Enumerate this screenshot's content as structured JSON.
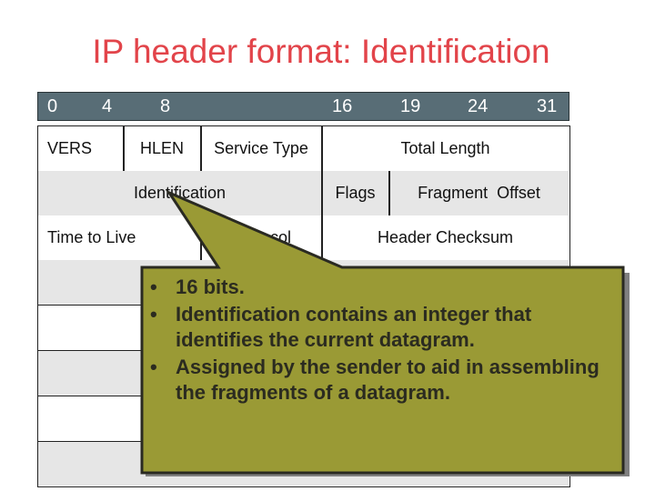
{
  "slide": {
    "title": "IP header format: Identification"
  },
  "bit_positions": [
    "0",
    "4",
    "8",
    "16",
    "19",
    "24",
    "31"
  ],
  "header_table": {
    "rows": [
      {
        "cells": [
          "VERS",
          "HLEN",
          "Service Type",
          "Total Length"
        ]
      },
      {
        "cells": [
          "Identification",
          "Flags",
          "Fragment  Offset"
        ]
      },
      {
        "cells": [
          "Time to Live",
          "Protocol",
          "Header Checksum"
        ]
      },
      {
        "cells": []
      },
      {
        "cells": []
      },
      {
        "cells": []
      },
      {
        "cells": []
      },
      {
        "cells": []
      }
    ]
  },
  "callout": {
    "highlighted_field": "Identification",
    "bullet_symbol": "•",
    "bullets": [
      "16 bits.",
      "Identification contains an integer that identifies the current datagram.",
      "Assigned by the sender to aid in assembling the fragments of a datagram."
    ],
    "colors": {
      "fill": "#9a9a35",
      "border": "#2a2a22",
      "shadow": "#808080"
    }
  }
}
